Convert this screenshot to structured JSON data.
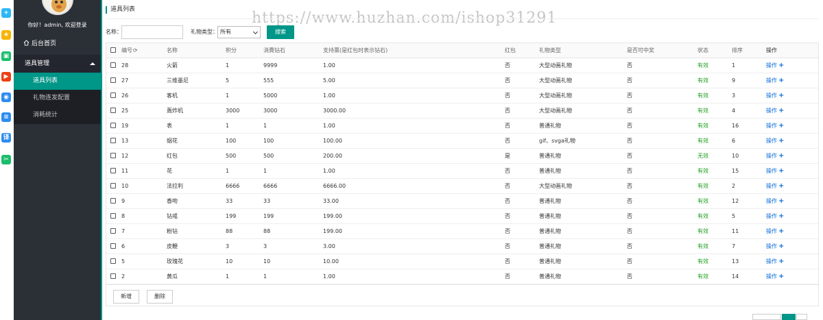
{
  "sidebar": {
    "greeting": "你好！admin, 欢迎登录",
    "home_label": "后台首页",
    "group_label": "道具管理",
    "items": [
      {
        "label": "道具列表"
      },
      {
        "label": "礼物连发配置"
      },
      {
        "label": "消耗统计"
      }
    ]
  },
  "icon_strip": [
    {
      "name": "plus-app-icon",
      "color": "#2db7f5",
      "glyph": "+"
    },
    {
      "name": "star-app-icon",
      "color": "#f7b500",
      "glyph": "★"
    },
    {
      "name": "image-app-icon",
      "color": "#19be6b",
      "glyph": "▣"
    },
    {
      "name": "video-app-icon",
      "color": "#ed4014",
      "glyph": "▶"
    },
    {
      "name": "disk-app-icon",
      "color": "#2d8cf0",
      "glyph": "◉"
    },
    {
      "name": "list-app-icon",
      "color": "#2d8cf0",
      "glyph": "≡"
    },
    {
      "name": "translate-app-icon",
      "color": "#2d8cf0",
      "glyph": "译"
    },
    {
      "name": "scissors-app-icon",
      "color": "#19be6b",
      "glyph": "✂"
    }
  ],
  "page": {
    "title": "道具列表",
    "watermark": "https://www.huzhan.com/ishop31291"
  },
  "search": {
    "name_label": "名称：",
    "name_value": "",
    "type_label": "礼物类型：",
    "type_value": "所有",
    "button": "搜索"
  },
  "table": {
    "headers": [
      "编号",
      "名称",
      "积分",
      "消費钻石",
      "支持票(是红包时表示钻石)",
      "红包",
      "礼物类型",
      "是否可中奖",
      "状态",
      "排序",
      "操作"
    ],
    "rows": [
      {
        "id": "28",
        "name": "火箭",
        "points": "1",
        "diamonds": "9999",
        "votes": "1.00",
        "redpack": "否",
        "type": "大型动画礼物",
        "lottery": "否",
        "status": "有效",
        "sort": "1",
        "op": "操作"
      },
      {
        "id": "27",
        "name": "三维墨尼",
        "points": "5",
        "diamonds": "555",
        "votes": "5.00",
        "redpack": "否",
        "type": "大型动画礼物",
        "lottery": "否",
        "status": "有效",
        "sort": "9",
        "op": "操作"
      },
      {
        "id": "26",
        "name": "客机",
        "points": "1",
        "diamonds": "5000",
        "votes": "1.00",
        "redpack": "否",
        "type": "大型动画礼物",
        "lottery": "否",
        "status": "有效",
        "sort": "3",
        "op": "操作"
      },
      {
        "id": "25",
        "name": "轰炸机",
        "points": "3000",
        "diamonds": "3000",
        "votes": "3000.00",
        "redpack": "否",
        "type": "大型动画礼物",
        "lottery": "否",
        "status": "有效",
        "sort": "4",
        "op": "操作"
      },
      {
        "id": "19",
        "name": "表",
        "points": "1",
        "diamonds": "1",
        "votes": "1.00",
        "redpack": "否",
        "type": "普通礼物",
        "lottery": "否",
        "status": "有效",
        "sort": "16",
        "op": "操作"
      },
      {
        "id": "13",
        "name": "烟花",
        "points": "100",
        "diamonds": "100",
        "votes": "100.00",
        "redpack": "否",
        "type": "gif、svga礼物",
        "lottery": "否",
        "status": "有效",
        "sort": "6",
        "op": "操作"
      },
      {
        "id": "12",
        "name": "红包",
        "points": "500",
        "diamonds": "500",
        "votes": "200.00",
        "redpack": "是",
        "type": "普通礼物",
        "lottery": "否",
        "status": "无效",
        "sort": "10",
        "op": "操作"
      },
      {
        "id": "11",
        "name": "花",
        "points": "1",
        "diamonds": "1",
        "votes": "1.00",
        "redpack": "否",
        "type": "普通礼物",
        "lottery": "否",
        "status": "有效",
        "sort": "15",
        "op": "操作"
      },
      {
        "id": "10",
        "name": "法拉利",
        "points": "6666",
        "diamonds": "6666",
        "votes": "6666.00",
        "redpack": "否",
        "type": "大型动画礼物",
        "lottery": "否",
        "status": "有效",
        "sort": "2",
        "op": "操作"
      },
      {
        "id": "9",
        "name": "香吻",
        "points": "33",
        "diamonds": "33",
        "votes": "33.00",
        "redpack": "否",
        "type": "普通礼物",
        "lottery": "否",
        "status": "有效",
        "sort": "12",
        "op": "操作"
      },
      {
        "id": "8",
        "name": "钻戒",
        "points": "199",
        "diamonds": "199",
        "votes": "199.00",
        "redpack": "否",
        "type": "普通礼物",
        "lottery": "否",
        "status": "有效",
        "sort": "5",
        "op": "操作"
      },
      {
        "id": "7",
        "name": "粉钻",
        "points": "88",
        "diamonds": "88",
        "votes": "199.00",
        "redpack": "否",
        "type": "普通礼物",
        "lottery": "否",
        "status": "有效",
        "sort": "11",
        "op": "操作"
      },
      {
        "id": "6",
        "name": "皮鞭",
        "points": "3",
        "diamonds": "3",
        "votes": "3.00",
        "redpack": "否",
        "type": "普通礼物",
        "lottery": "否",
        "status": "有效",
        "sort": "7",
        "op": "操作"
      },
      {
        "id": "5",
        "name": "玫瑰花",
        "points": "10",
        "diamonds": "10",
        "votes": "10.00",
        "redpack": "否",
        "type": "普通礼物",
        "lottery": "否",
        "status": "有效",
        "sort": "13",
        "op": "操作"
      },
      {
        "id": "2",
        "name": "黄瓜",
        "points": "1",
        "diamonds": "1",
        "votes": "1.00",
        "redpack": "否",
        "type": "普通礼物",
        "lottery": "否",
        "status": "有效",
        "sort": "14",
        "op": "操作"
      }
    ]
  },
  "footer": {
    "add_label": "新增",
    "delete_label": "删除"
  },
  "colors": {
    "accent": "#009688",
    "sidebar": "#2b2f36",
    "valid": "#1e9e1e",
    "link": "#0a6bd6"
  }
}
